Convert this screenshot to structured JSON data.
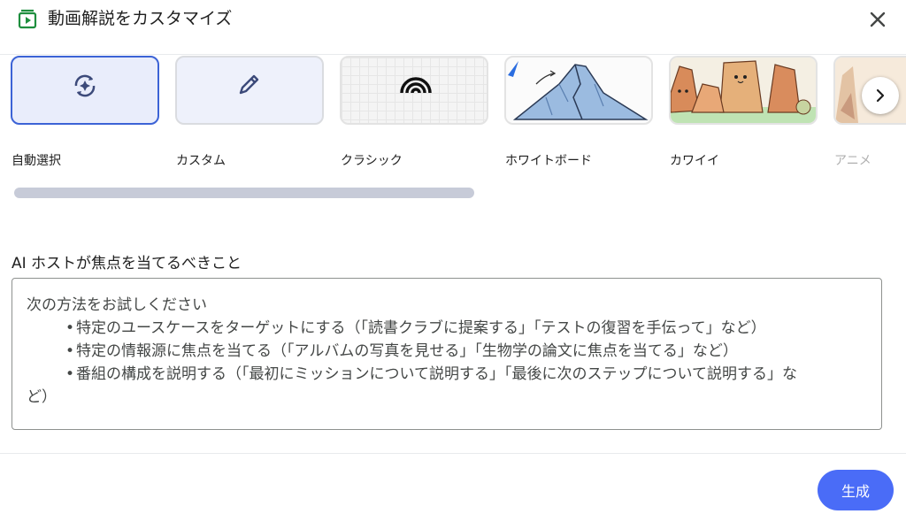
{
  "dialog": {
    "title": "動画解説をカスタマイズ",
    "header_icon": "video-library-icon",
    "close_icon": "close-icon"
  },
  "styles": {
    "selected_index": 0,
    "items": [
      {
        "label": "自動選択",
        "icon": "auto-select-sparkle-icon"
      },
      {
        "label": "カスタム",
        "icon": "pencil-icon"
      },
      {
        "label": "クラシック",
        "icon": "rainbow-arc-icon"
      },
      {
        "label": "ホワイトボード",
        "icon": "whiteboard-mountain-thumbnail"
      },
      {
        "label": "カワイイ",
        "icon": "kawaii-rocks-thumbnail"
      },
      {
        "label": "アニメ",
        "icon": "anime-thumbnail"
      }
    ],
    "next_icon": "chevron-right-icon"
  },
  "focus": {
    "label": "AI ホストが焦点を当てるべきこと",
    "placeholder_intro": "次の方法をお試しください",
    "placeholder_bullets": [
      "特定のユースケースをターゲットにする（「読書クラブに提案する」「テストの復習を手伝って」など）",
      "特定の情報源に焦点を当てる（「アルバムの写真を見せる」「生物学の論文に焦点を当てる」など）",
      "番組の構成を説明する（「最初にミッションについて説明する」「最後に次のステップについて説明する」な"
    ],
    "placeholder_wrap": "ど）",
    "value": ""
  },
  "footer": {
    "generate_label": "生成"
  },
  "colors": {
    "accent": "#3c63d6",
    "button": "#4a6cf7",
    "header_icon": "#1e8e3e"
  }
}
